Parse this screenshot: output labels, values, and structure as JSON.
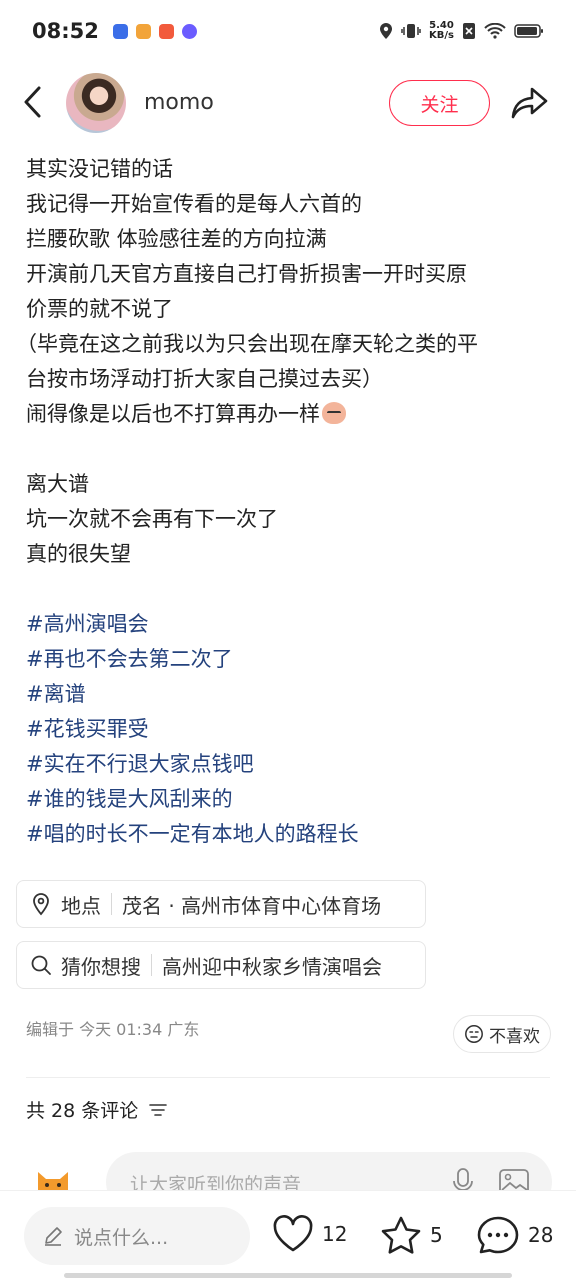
{
  "status_bar": {
    "time": "08:52",
    "net_speed_value": "5.40",
    "net_speed_unit": "KB/s",
    "app_icon_colors": [
      "#3b6ee8",
      "#f2a43a",
      "#f25a3c",
      "#6b5cff"
    ]
  },
  "header": {
    "author_name": "momo",
    "follow_label": "关注"
  },
  "post": {
    "lines": [
      "其实没记错的话",
      "我记得一开始宣传看的是每人六首的",
      "拦腰砍歌 体验感往差的方向拉满",
      "开演前几天官方直接自己打骨折损害一开时买原",
      "价票的就不说了",
      "（毕竟在这之前我以为只会出现在摩天轮之类的平",
      "台按市场浮动打折大家自己摸过去买）",
      "闹得像是以后也不打算再办一样"
    ],
    "lines2": [
      "离大谱",
      "坑一次就不会再有下一次了",
      "真的很失望"
    ],
    "hashtags": [
      "#高州演唱会",
      "#再也不会去第二次了",
      "#离谱",
      "#花钱买罪受",
      "#实在不行退大家点钱吧",
      "#谁的钱是大风刮来的",
      "#唱的时长不一定有本地人的路程长"
    ]
  },
  "location_chip": {
    "label": "地点",
    "value": "茂名 · 高州市体育中心体育场"
  },
  "search_chip": {
    "label": "猜你想搜",
    "value": "高州迎中秋家乡情演唱会"
  },
  "meta": {
    "edit_text": "编辑于 今天 01:34 广东",
    "dislike_label": "不喜欢"
  },
  "comments": {
    "heading": "共 28 条评论",
    "input_placeholder": "让大家听到你的声音"
  },
  "bottom_bar": {
    "say_placeholder": "说点什么...",
    "likes": "12",
    "collects": "5",
    "comments": "28"
  },
  "colors": {
    "accent": "#ff2e4d",
    "hashtag": "#24427d"
  }
}
